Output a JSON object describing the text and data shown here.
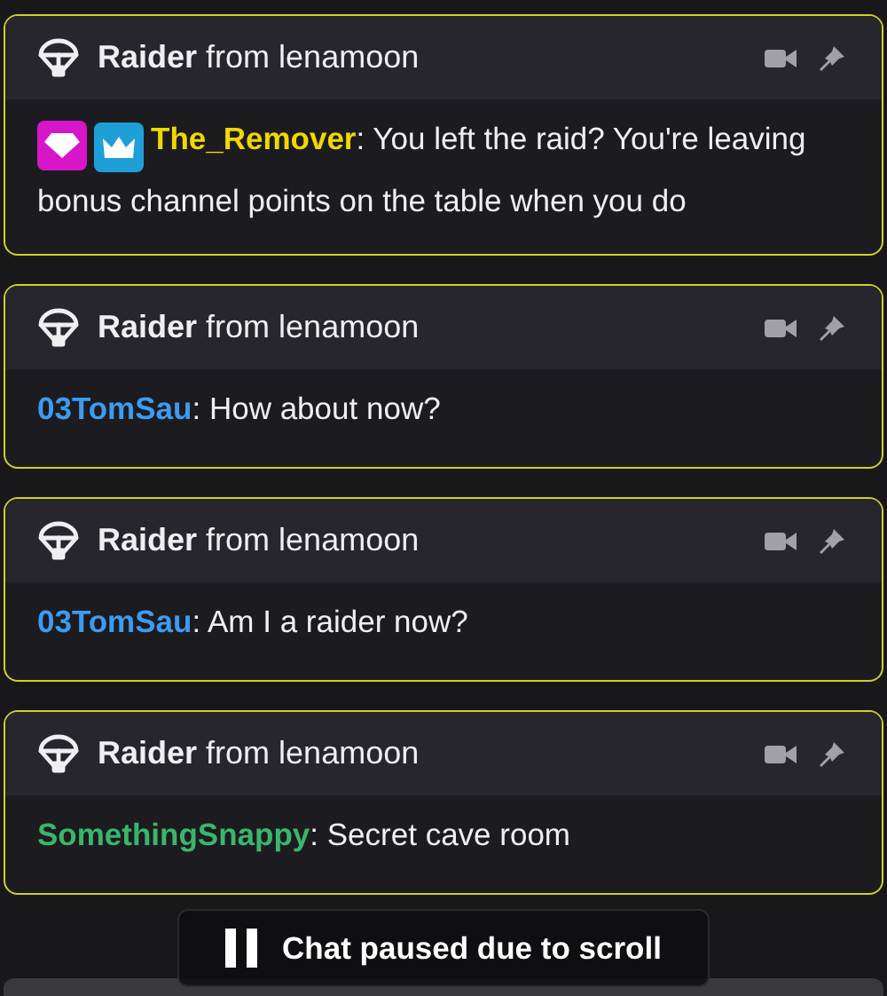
{
  "messages": [
    {
      "header": {
        "label": "Raider",
        "from": "from lenamoon"
      },
      "badges": [
        {
          "color": "#d616c8"
        },
        {
          "color": "#1e9fd8"
        }
      ],
      "user": "The_Remover",
      "separator": ":",
      "color": "#f0d800",
      "text": "You left the raid? You're leaving bonus channel points on the table when you do"
    },
    {
      "header": {
        "label": "Raider",
        "from": "from lenamoon"
      },
      "user": "03TomSau",
      "separator": ":",
      "color": "#3d9bf0",
      "text": "How about now?"
    },
    {
      "header": {
        "label": "Raider",
        "from": "from lenamoon"
      },
      "user": "03TomSau",
      "separator": ":",
      "color": "#3d9bf0",
      "text": "Am I a raider now?"
    },
    {
      "header": {
        "label": "Raider",
        "from": "from lenamoon"
      },
      "user": "SomethingSnappy",
      "separator": ":",
      "color": "#3bb56d",
      "text": "Secret cave room"
    }
  ],
  "paused_banner": {
    "text": "Chat paused due to scroll"
  }
}
